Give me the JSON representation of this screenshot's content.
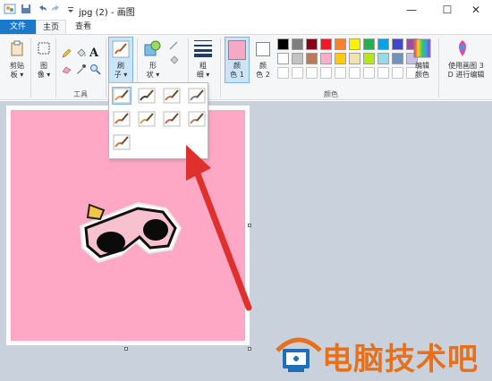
{
  "window": {
    "title": "jpg (2) - 画图",
    "minimize": "—",
    "maximize": "☐",
    "close": "✕"
  },
  "tabs": [
    {
      "label": "文件"
    },
    {
      "label": "主页"
    },
    {
      "label": "查看"
    }
  ],
  "ribbon": {
    "clipboard": {
      "paste_line1": "剪贴",
      "paste_line2": "板 ▾"
    },
    "image": {
      "label_line1": "图",
      "label_line2": "像 ▾"
    },
    "tools": {
      "group_label": "工具"
    },
    "brushes": {
      "label_line1": "刷",
      "label_line2": "子 ▾"
    },
    "shapes": {
      "label_line1": "形",
      "label_line2": "状 ▾"
    },
    "size": {
      "label_line1": "粗",
      "label_line2": "细 ▾"
    },
    "color1": {
      "label_line1": "颜",
      "label_line2": "色 1"
    },
    "color2": {
      "label_line1": "颜",
      "label_line2": "色 2"
    },
    "colors": {
      "group_label": "颜色"
    },
    "edit_colors": {
      "label_line1": "编辑",
      "label_line2": "颜色"
    },
    "paint3d": {
      "label_line1": "使用画图 3",
      "label_line2": "D 进行编辑"
    },
    "palette_row1": [
      "#000000",
      "#7f7f7f",
      "#880015",
      "#ed1c24",
      "#ff7f27",
      "#fff200",
      "#22b14c",
      "#00a2e8",
      "#3f48cc",
      "#a349a4"
    ],
    "palette_row2": [
      "#ffffff",
      "#c3c3c3",
      "#b97a57",
      "#ffaec9",
      "#ffc90e",
      "#efe4b0",
      "#b5e61d",
      "#99d9ea",
      "#7092be",
      "#c8bfe7"
    ],
    "color1_value": "#f6a9c6",
    "color2_value": "#ffffff"
  },
  "brush_menu": {
    "items": [
      "brush",
      "calligraphy-brush-1",
      "calligraphy-brush-2",
      "airbrush",
      "oil-brush",
      "crayon",
      "marker",
      "natural-pencil",
      "watercolor-brush"
    ]
  },
  "watermark": {
    "text": "电脑技术吧"
  }
}
